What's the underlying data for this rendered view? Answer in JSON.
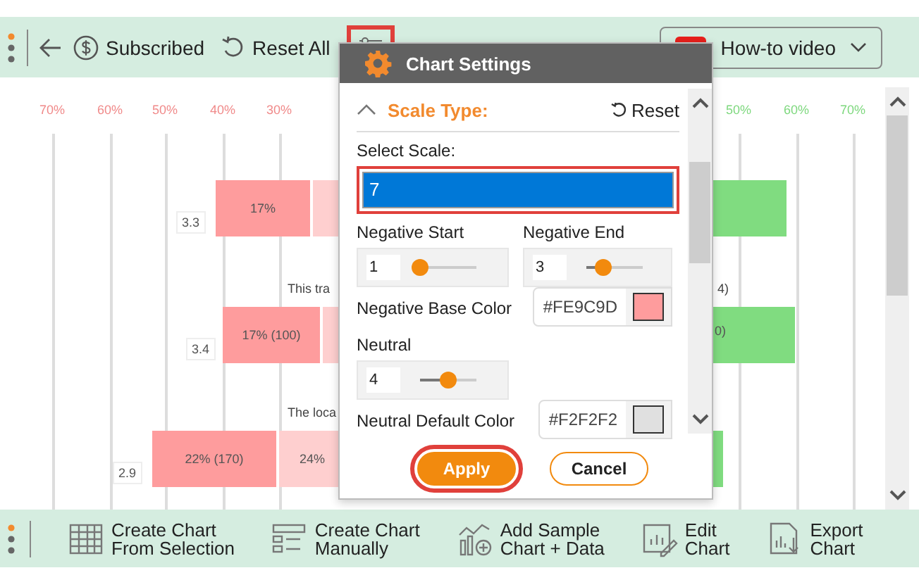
{
  "toolbar": {
    "buttons": [
      {
        "kind": "subscribed",
        "label": "Subscribed"
      },
      {
        "kind": "reset",
        "label": "Reset All"
      },
      {
        "kind": "settings",
        "highlighted": true
      }
    ],
    "video_button": {
      "label": "How-to video"
    }
  },
  "chart": {
    "left_ticks": [
      "70%",
      "60%",
      "50%",
      "40%",
      "30%"
    ],
    "right_ticks": [
      "50%",
      "60%",
      "70%"
    ],
    "rows": [
      {
        "score": "3.3",
        "strong_label": "17%"
      },
      {
        "score": "3.4",
        "strong_label": "17% (100)",
        "note": "This tra",
        "note_right": "4)",
        "pos_label": "0)"
      },
      {
        "score": "2.9",
        "strong_label": "22% (170)",
        "light_label": "24%",
        "note": "The loca"
      }
    ]
  },
  "dialog": {
    "title": "Chart Settings",
    "section": {
      "title": "Scale Type:",
      "expanded": true,
      "reset": "Reset"
    },
    "select_label": "Select Scale:",
    "select_value": "7",
    "select_highlighted": true,
    "fields": [
      {
        "kind": "slider",
        "label": "Negative Start",
        "value": "1",
        "level": 0.0
      },
      {
        "kind": "slider",
        "label": "Negative End",
        "value": "3",
        "level": 0.3
      },
      {
        "kind": "color",
        "label": "Negative Base Color",
        "value": "#FE9C9D",
        "color": "#fe9c9d"
      },
      {
        "kind": "slider",
        "label": "Neutral",
        "value": "4",
        "level": 0.5
      },
      {
        "kind": "color",
        "label": "Neutral Default Color",
        "value": "#F2F2F2",
        "color": "#e0e0e0"
      }
    ],
    "buttons": [
      {
        "kind": "primary",
        "label": "Apply",
        "highlighted": true
      },
      {
        "kind": "secondary",
        "label": "Cancel",
        "highlighted": false
      }
    ]
  },
  "bottom_bar": [
    {
      "kind": "table",
      "label": "Create Chart\nFrom Selection"
    },
    {
      "kind": "manual",
      "label": "Create Chart\nManually"
    },
    {
      "kind": "sample",
      "label": "Add Sample\nChart + Data"
    },
    {
      "kind": "edit",
      "label": "Edit\nChart"
    },
    {
      "kind": "export",
      "label": "Export\nChart"
    }
  ]
}
